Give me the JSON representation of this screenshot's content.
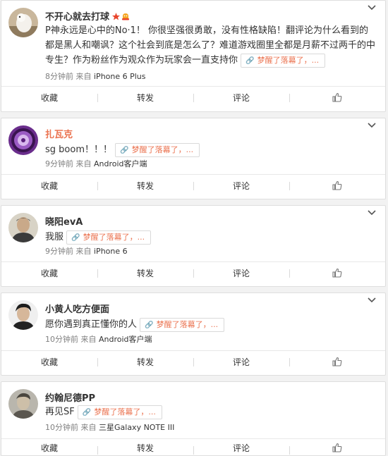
{
  "comments": [
    {
      "username": "不开心就去打球",
      "text": "P神永远是心中的No·1！ 你很坚强很勇敢，没有性格缺陷！翻评论为什么看到的都是黑人和嘲讽？这个社会到底是怎么了？难道游戏圈里全都是月薪不过两千的中专生？作为粉丝作为观众作为玩家会一直支持你",
      "reply_tag": "梦醒了落幕了，...",
      "time": "8分钟前",
      "source_prefix": "来自",
      "device": "iPhone 6 Plus",
      "avatar_icon": "dog-photo-avatar"
    },
    {
      "username": "扎瓦克",
      "text": "sg boom！！！",
      "reply_tag": "梦醒了落幕了，...",
      "time": "9分钟前",
      "source_prefix": "来自",
      "device": "Android客户端",
      "avatar_icon": "purple-badge-avatar"
    },
    {
      "username": "晓阳evA",
      "text": "我服",
      "reply_tag": "梦醒了落幕了，...",
      "time": "9分钟前",
      "source_prefix": "来自",
      "device": "iPhone 6",
      "avatar_icon": "man-photo-avatar"
    },
    {
      "username": "小黄人吃方便面",
      "text": "愿你遇到真正懂你的人",
      "reply_tag": "梦醒了落幕了，...",
      "time": "10分钟前",
      "source_prefix": "来自",
      "device": "Android客户端",
      "avatar_icon": "dark-hair-man-avatar"
    },
    {
      "username": "约翰尼德PP",
      "text": "再见SF",
      "reply_tag": "梦醒了落幕了，...",
      "time": "10分钟前",
      "source_prefix": "来自",
      "device": "三星Galaxy NOTE III",
      "avatar_icon": "grey-photo-avatar"
    }
  ],
  "actions": {
    "favorite": "收藏",
    "repost": "转发",
    "comment": "评论",
    "like_icon": "thumbs-up-icon"
  },
  "colors": {
    "accent": "#eb7350",
    "meta": "#808080",
    "background": "#f2f2f2"
  }
}
